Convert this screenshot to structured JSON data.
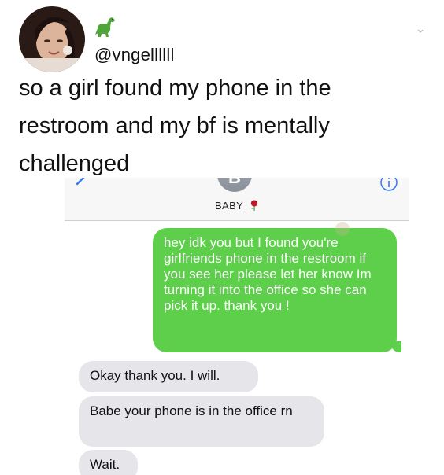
{
  "tweet": {
    "emoji": "dinosaur-emoji",
    "handle": "@vngellllll",
    "text": "so a girl found my phone in the restroom and my bf is mentally challenged"
  },
  "conversation": {
    "contact_initial": "B",
    "contact_name": "BABY",
    "contact_emoji": "rose-emoji",
    "messages": [
      {
        "from": "me",
        "text": "hey idk you but I found you're girlfriends phone in the restroom if you see her please let her know Im turning it into the office so she can pick it up. thank you !"
      },
      {
        "from": "them",
        "text": "Okay thank you. I will."
      },
      {
        "from": "them",
        "text": "Babe your phone is in the office rn"
      },
      {
        "from": "them",
        "text": "Wait."
      }
    ]
  },
  "colors": {
    "sent_bubble": "#5dcf4a",
    "received_bubble": "#e5e5ea",
    "ios_blue": "#3478f6"
  }
}
